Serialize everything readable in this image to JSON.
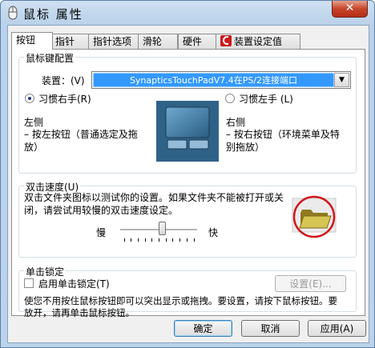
{
  "window": {
    "title": "鼠标 属性",
    "close_symbol": "✕"
  },
  "tabs": [
    {
      "label": "按钮",
      "active": true
    },
    {
      "label": "指针"
    },
    {
      "label": "指针选项"
    },
    {
      "label": "滑轮"
    },
    {
      "label": "硬件"
    },
    {
      "label": "装置设定值"
    }
  ],
  "button_config": {
    "legend": "鼠标键配置",
    "device_label": "装置：(V)",
    "device_value": "SynapticsTouchPadV7.4在PS/2连接端口",
    "right_hand_label": "习惯右手(R)",
    "left_hand_label": "习惯左手 (L)",
    "left_heading": "左侧",
    "left_desc": "– 按左按钮（普通选定及拖放）",
    "right_heading": "右侧",
    "right_desc": "– 按右按钮（环境菜单及特别拖放）"
  },
  "double_click": {
    "legend": "双击速度(U)",
    "desc": "双击文件夹图标以测试你的设置。如果文件夹不能被打开或关闭，请尝试用较慢的双击速度设定。",
    "slow": "慢",
    "fast": "快",
    "speed_fraction": 0.55
  },
  "click_lock": {
    "legend": "单击锁定",
    "enable_label": "启用单击锁定(T)",
    "settings_button": "设置(E)...",
    "desc": "使您不用按住鼠标按钮即可以突出显示或拖拽。要设置，请按下鼠标按钮。要放开，请再单击鼠标按钮。"
  },
  "footer": {
    "ok": "确定",
    "cancel": "取消",
    "apply": "应用(A)"
  },
  "colors": {
    "selection": "#3399ff",
    "highlight_circle": "#d0141b",
    "folder": "#c9b54a"
  }
}
